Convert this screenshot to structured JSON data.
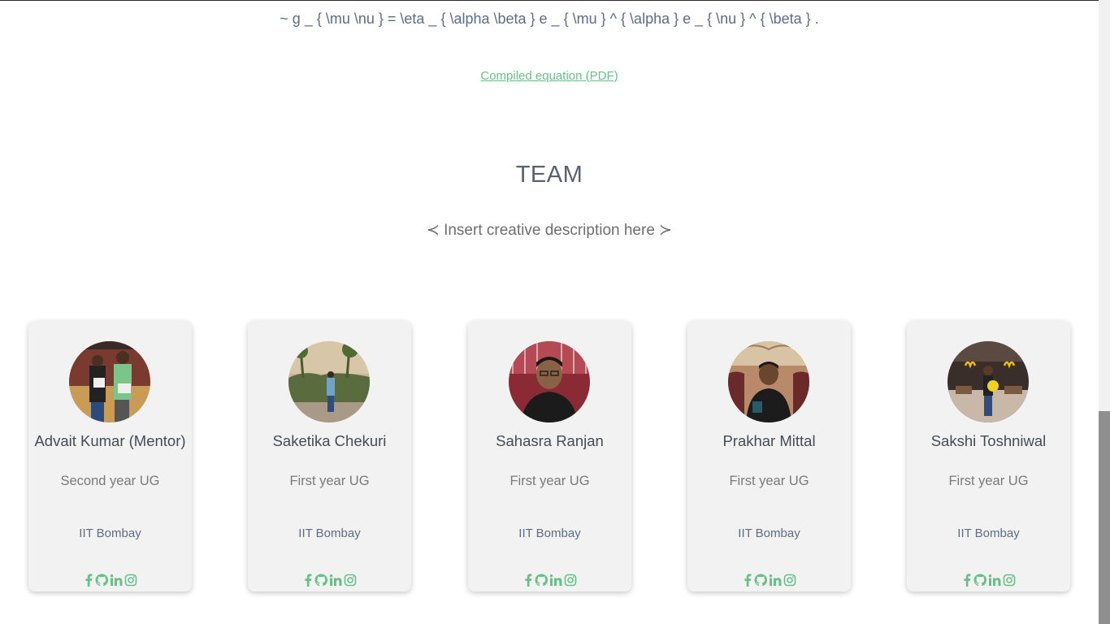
{
  "equation": {
    "text": "~ g _ { \\mu \\nu } = \\eta _ { \\alpha \\beta } e _ { \\mu } ^ { \\alpha } e _ { \\nu } ^ { \\beta } ."
  },
  "pdf_link": {
    "label": "Compiled equation (PDF)"
  },
  "team": {
    "title": "TEAM",
    "description": "≺ Insert creative description here ≻"
  },
  "members": [
    {
      "name": "Advait Kumar (Mentor)",
      "year": "Second year UG",
      "college": "IIT Bombay"
    },
    {
      "name": "Saketika Chekuri",
      "year": "First year UG",
      "college": "IIT Bombay"
    },
    {
      "name": "Sahasra Ranjan",
      "year": "First year UG",
      "college": "IIT Bombay"
    },
    {
      "name": "Prakhar Mittal",
      "year": "First year UG",
      "college": "IIT Bombay"
    },
    {
      "name": "Sakshi Toshniwal",
      "year": "First year UG",
      "college": "IIT Bombay"
    }
  ],
  "social_icons": [
    "facebook-icon",
    "github-icon",
    "linkedin-icon",
    "instagram-icon"
  ],
  "colors": {
    "accent_green": "#67c08a",
    "card_bg": "#f2f2f2",
    "text_blue_gray": "#5e6c84"
  }
}
